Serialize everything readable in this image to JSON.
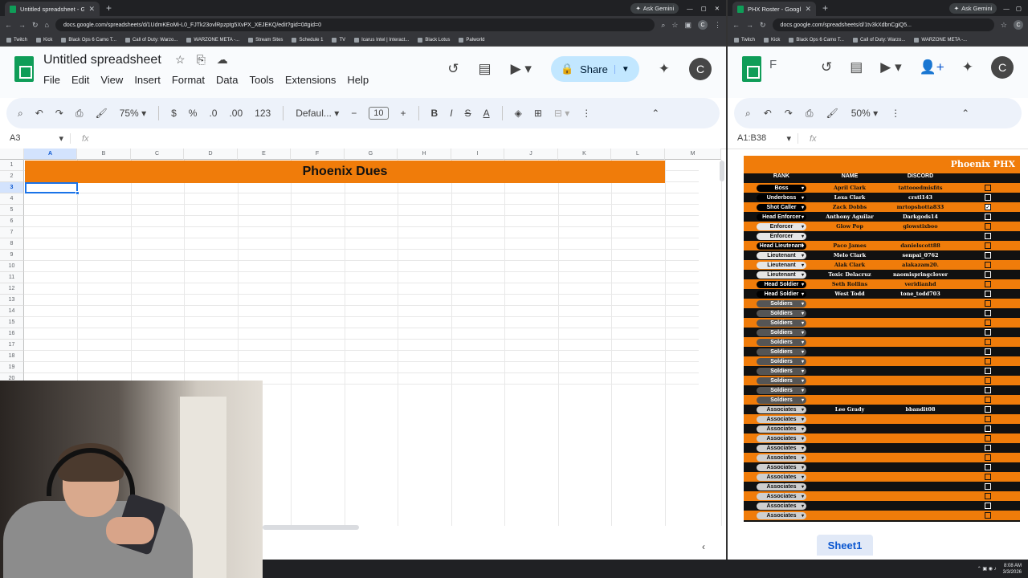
{
  "left_window": {
    "tab_title": "Untitled spreadsheet - Google",
    "ask_gemini": "Ask Gemini",
    "url": "docs.google.com/spreadsheets/d/1UdmKEoMi-L0_FJTk23ovlRpzptg5XvPX_XEJEKQ/edit?gid=0#gid=0",
    "avatar": "C",
    "bookmarks": [
      "Twitch",
      "Kick",
      "Black Ops 6 Camo T...",
      "Call of Duty: Warzo...",
      "WARZONE META -...",
      "Stream Sites",
      "Schedule 1",
      "TV",
      "Icarus Intel | Interact...",
      "Black Lotus",
      "Palworld"
    ],
    "doc_title": "Untitled spreadsheet",
    "menu": [
      "File",
      "Edit",
      "View",
      "Insert",
      "Format",
      "Data",
      "Tools",
      "Extensions",
      "Help"
    ],
    "share_label": "Share",
    "toolbar": {
      "zoom": "75%",
      "currency": "$",
      "percent": "%",
      "decrease_decimal": ".0",
      "increase_decimal": ".00",
      "number_format": "123",
      "font": "Defaul...",
      "font_size": "10",
      "bold": "B",
      "italic": "I",
      "strike": "S",
      "text_color": "A"
    },
    "name_box": "A3",
    "fx": "fx",
    "columns": [
      "A",
      "B",
      "C",
      "D",
      "E",
      "F",
      "G",
      "H",
      "I",
      "J",
      "K",
      "L",
      "M"
    ],
    "rows": [
      "1",
      "2",
      "3",
      "4",
      "5",
      "6",
      "7",
      "8",
      "9",
      "10",
      "11",
      "12",
      "13",
      "14",
      "15",
      "16",
      "17",
      "18",
      "19",
      "20"
    ],
    "banner_text": "Phoenix Dues",
    "banner_color": "#f07c0a"
  },
  "right_window": {
    "tab_title": "PHX Roster - Google Sheets",
    "ask_gemini": "Ask Gemini",
    "url": "docs.google.com/spreadsheets/d/1tv3kXdbnCgiQ5...",
    "bookmarks": [
      "Twitch",
      "Kick",
      "Black Ops 6 Camo T...",
      "Call of Duty: Warzo...",
      "WARZONE META -..."
    ],
    "doc_title_initial": "F",
    "avatar": "C",
    "zoom": "50%",
    "name_box": "A1:B38",
    "fx": "fx",
    "sheet_tab": "Sheet1",
    "banner_text": "Phoenix PHX",
    "headers": {
      "rank": "RANK",
      "name": "NAME",
      "discord": "DISCORD"
    },
    "roster": [
      {
        "row": "4",
        "rank": "Boss",
        "name": "April Clark",
        "discord": "tattooedmisfits",
        "checked": false
      },
      {
        "row": "5",
        "rank": "Underboss",
        "name": "Lexa Clark",
        "discord": "crstl143",
        "checked": false
      },
      {
        "row": "6",
        "rank": "Shot Caller",
        "name": "Zack Dobbs",
        "discord": "mrtopshotta833",
        "checked": true
      },
      {
        "row": "7",
        "rank": "Head Enforcer",
        "name": "Anthony Aguilar",
        "discord": "Darkgods14",
        "checked": false
      },
      {
        "row": "8",
        "rank": "Enforcer",
        "name": "Glow Pop",
        "discord": "glowstixboo",
        "checked": false
      },
      {
        "row": "9",
        "rank": "Enforcer",
        "name": "",
        "discord": "",
        "checked": false
      },
      {
        "row": "10",
        "rank": "Head Lieutenant",
        "name": "Paco James",
        "discord": "danielscott88",
        "checked": false
      },
      {
        "row": "11",
        "rank": "Lieutenant",
        "name": "Melo Clark",
        "discord": "senpai_0762",
        "checked": false
      },
      {
        "row": "12",
        "rank": "Lieutenant",
        "name": "Alak Clark",
        "discord": "alakazam20.",
        "checked": false
      },
      {
        "row": "13",
        "rank": "Lieutenant",
        "name": "Toxic Delacruz",
        "discord": "naomispringclover",
        "checked": false
      },
      {
        "row": "14",
        "rank": "Head Soldier",
        "name": "Seth Rollins",
        "discord": "veridianhd",
        "checked": false
      },
      {
        "row": "15",
        "rank": "Head Soldier",
        "name": "West Todd",
        "discord": "tone_todd703",
        "checked": false
      },
      {
        "row": "16",
        "rank": "Soldiers",
        "name": "",
        "discord": "",
        "checked": false
      },
      {
        "row": "17",
        "rank": "Soldiers",
        "name": "",
        "discord": "",
        "checked": false
      },
      {
        "row": "18",
        "rank": "Soldiers",
        "name": "",
        "discord": "",
        "checked": false
      },
      {
        "row": "19",
        "rank": "Soldiers",
        "name": "",
        "discord": "",
        "checked": false
      },
      {
        "row": "20",
        "rank": "Soldiers",
        "name": "",
        "discord": "",
        "checked": false
      },
      {
        "row": "21",
        "rank": "Soldiers",
        "name": "",
        "discord": "",
        "checked": false
      },
      {
        "row": "22",
        "rank": "Soldiers",
        "name": "",
        "discord": "",
        "checked": false
      },
      {
        "row": "23",
        "rank": "Soldiers",
        "name": "",
        "discord": "",
        "checked": false
      },
      {
        "row": "24",
        "rank": "Soldiers",
        "name": "",
        "discord": "",
        "checked": false
      },
      {
        "row": "25",
        "rank": "Soldiers",
        "name": "",
        "discord": "",
        "checked": false
      },
      {
        "row": "26",
        "rank": "Soldiers",
        "name": "",
        "discord": "",
        "checked": false
      },
      {
        "row": "27",
        "rank": "Associates",
        "name": "Lee Grady",
        "discord": "bbandit08",
        "checked": false
      },
      {
        "row": "28",
        "rank": "Associates",
        "name": "",
        "discord": "",
        "checked": false
      },
      {
        "row": "29",
        "rank": "Associates",
        "name": "",
        "discord": "",
        "checked": false
      },
      {
        "row": "30",
        "rank": "Associates",
        "name": "",
        "discord": "",
        "checked": false
      },
      {
        "row": "31",
        "rank": "Associates",
        "name": "",
        "discord": "",
        "checked": false
      },
      {
        "row": "32",
        "rank": "Associates",
        "name": "",
        "discord": "",
        "checked": false
      },
      {
        "row": "33",
        "rank": "Associates",
        "name": "",
        "discord": "",
        "checked": false
      },
      {
        "row": "34",
        "rank": "Associates",
        "name": "",
        "discord": "",
        "checked": false
      },
      {
        "row": "35",
        "rank": "Associates",
        "name": "",
        "discord": "",
        "checked": false
      },
      {
        "row": "36",
        "rank": "Associates",
        "name": "",
        "discord": "",
        "checked": false
      },
      {
        "row": "37",
        "rank": "Associates",
        "name": "",
        "discord": "",
        "checked": false
      },
      {
        "row": "38",
        "rank": "Associates",
        "name": "",
        "discord": "",
        "checked": false
      }
    ]
  },
  "taskbar": {
    "time": "8:08 AM",
    "date": "3/3/2026"
  }
}
